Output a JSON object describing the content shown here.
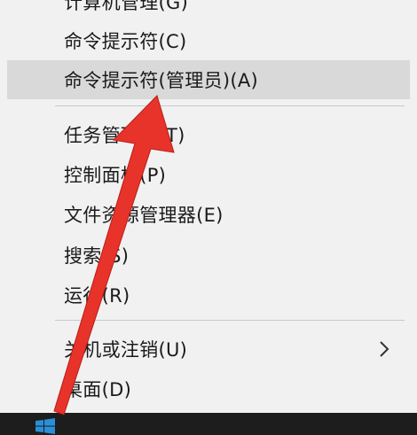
{
  "menu": {
    "items": [
      {
        "label": "计算机管理(G)"
      },
      {
        "label": "命令提示符(C)"
      },
      {
        "label": "命令提示符(管理员)(A)"
      },
      {
        "label": "任务管理器(T)"
      },
      {
        "label": "控制面板(P)"
      },
      {
        "label": "文件资源管理器(E)"
      },
      {
        "label": "搜索(S)"
      },
      {
        "label": "运行(R)"
      },
      {
        "label": "关机或注销(U)"
      },
      {
        "label": "桌面(D)"
      }
    ]
  },
  "icons": {
    "submenu": "chevron-right-icon",
    "start": "windows-logo-icon",
    "annotation": "red-arrow-annotation"
  },
  "colors": {
    "highlight": "#d9d9d9",
    "arrow": "#e8332a",
    "taskbar": "#1d1d1d"
  }
}
